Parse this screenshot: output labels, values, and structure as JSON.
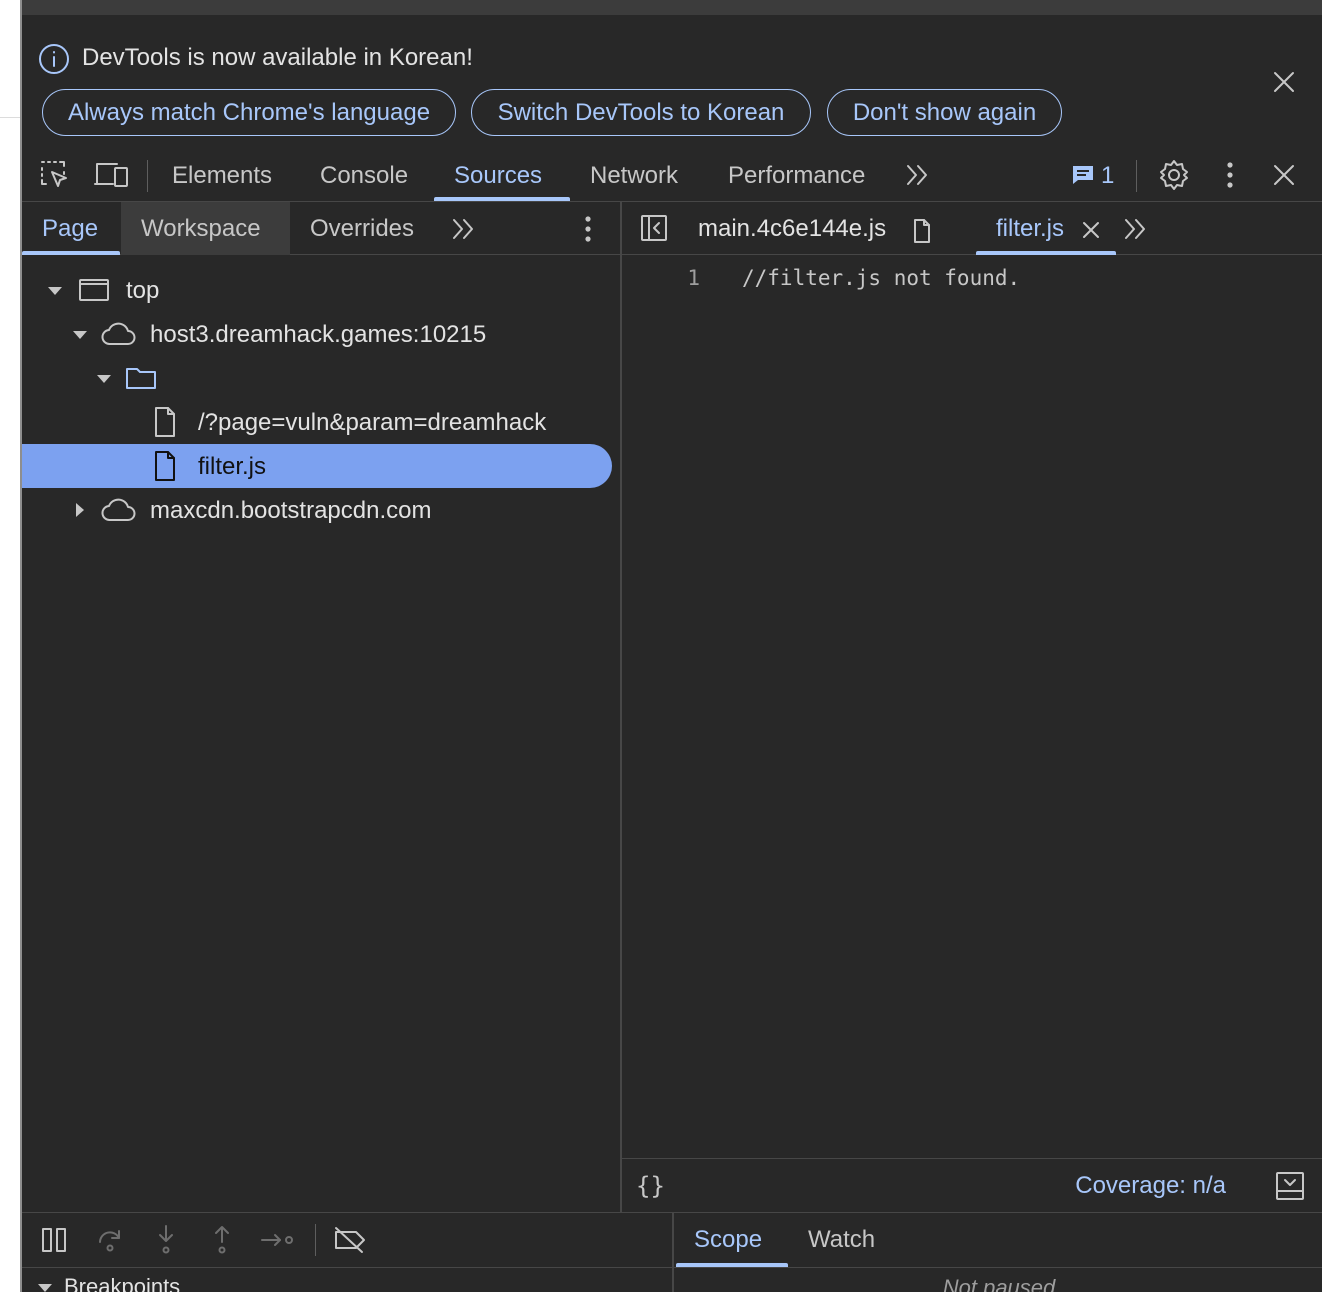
{
  "infobar": {
    "message": "DevTools is now available in Korean!",
    "buttons": {
      "always_match": "Always match Chrome's language",
      "switch": "Switch DevTools to Korean",
      "dont_show": "Don't show again"
    }
  },
  "main_toolbar": {
    "tabs": [
      "Elements",
      "Console",
      "Sources",
      "Network",
      "Performance"
    ],
    "active_tab": "Sources",
    "issues_count": "1"
  },
  "navigator": {
    "tabs": [
      "Page",
      "Workspace",
      "Overrides"
    ],
    "active_tab": "Page",
    "tree": {
      "top": "top",
      "host": "host3.dreamhack.games:10215",
      "folder": "",
      "file_page": "/?page=vuln&param=dreamhack",
      "file_filter": "filter.js",
      "cdn": "maxcdn.bootstrapcdn.com"
    },
    "selected": "filter.js"
  },
  "editor": {
    "tabs": [
      "main.4c6e144e.js",
      "filter.js"
    ],
    "active_tab": "filter.js",
    "lines": [
      {
        "number": "1",
        "code": "//filter.js not found."
      }
    ],
    "footer": {
      "pretty_print": "{}",
      "coverage": "Coverage: n/a"
    }
  },
  "debugger": {
    "side_tabs": [
      "Scope",
      "Watch"
    ],
    "active_side_tab": "Scope",
    "breakpoints_label": "Breakpoints",
    "not_paused": "Not paused"
  },
  "colors": {
    "accent": "#a8c7fa",
    "background": "#282828",
    "selection": "#7ca1f0"
  }
}
